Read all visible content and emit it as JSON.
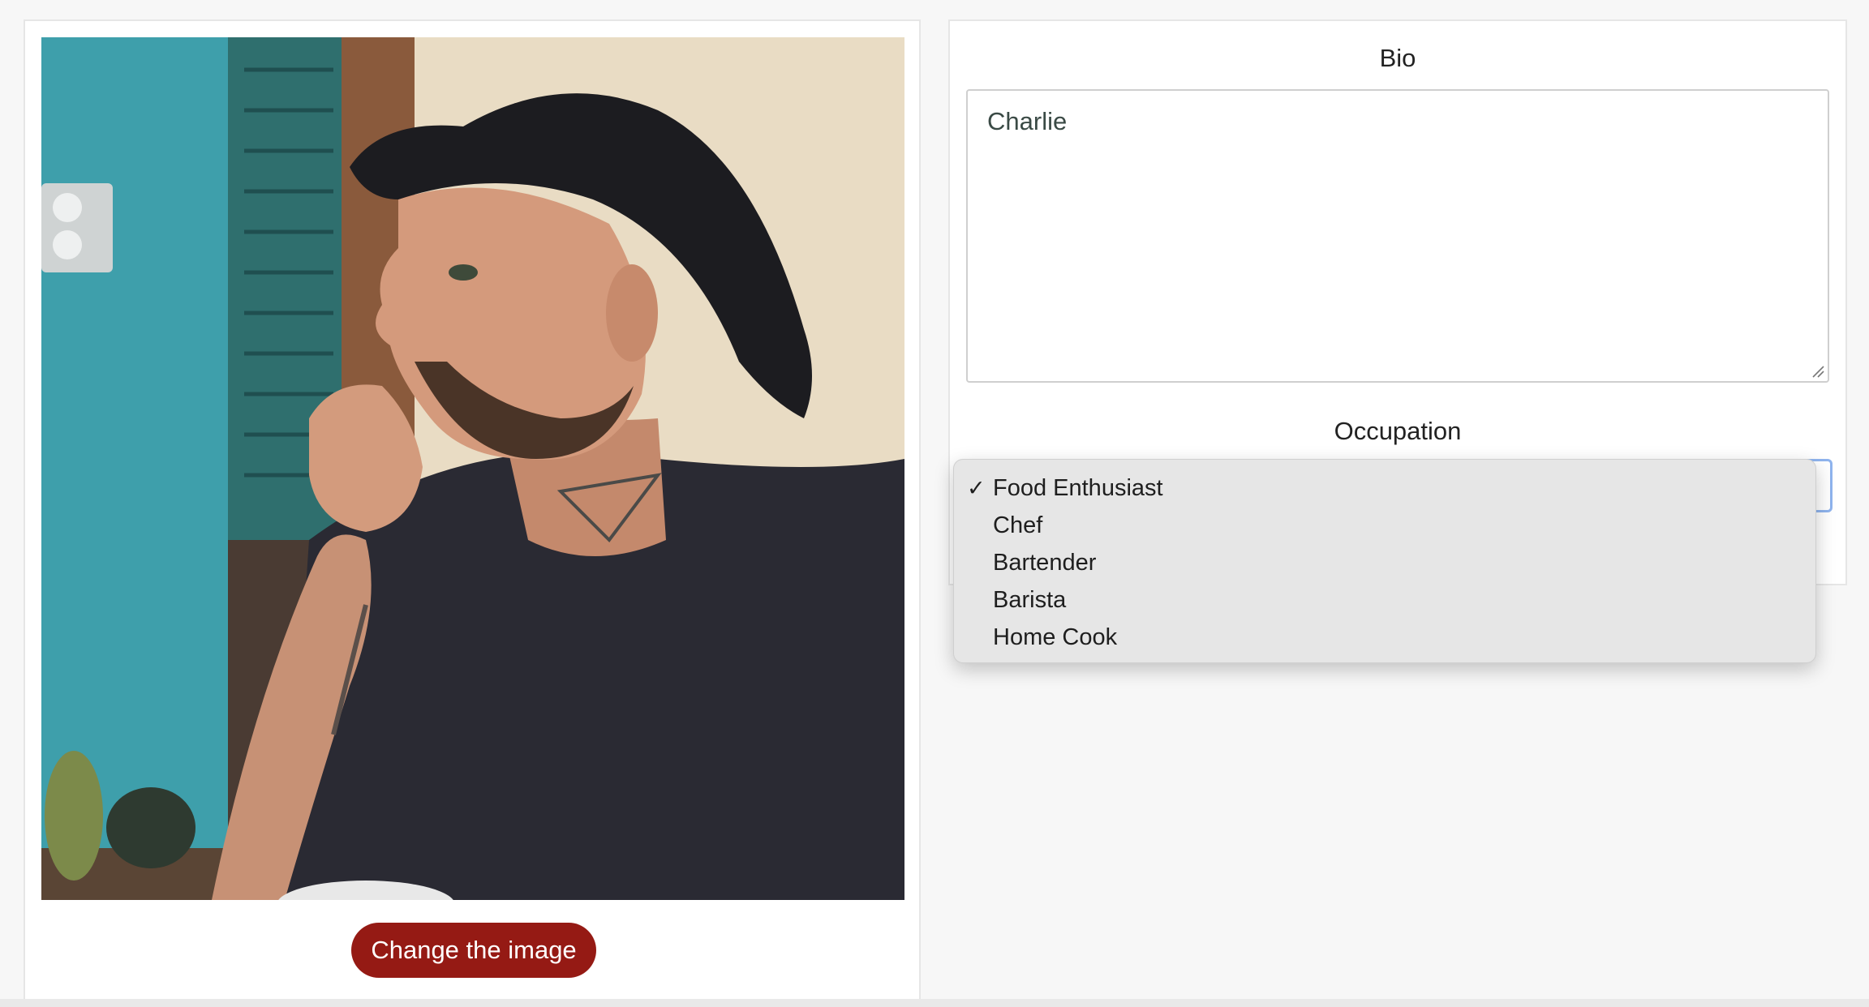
{
  "left_panel": {
    "photo_alt": "profile photo",
    "change_image_label": "Change the image"
  },
  "right_panel": {
    "bio_label": "Bio",
    "bio_value": "Charlie",
    "occupation_label": "Occupation",
    "occupation_selected": "Food Enthusiast",
    "occupation_options": [
      "Food Enthusiast",
      "Chef",
      "Bartender",
      "Barista",
      "Home Cook"
    ],
    "check_mark": "✓"
  },
  "colors": {
    "primary_button": "#951a14",
    "select_focus_border": "#8fb4ee",
    "dropdown_bg": "#e6e6e6"
  }
}
